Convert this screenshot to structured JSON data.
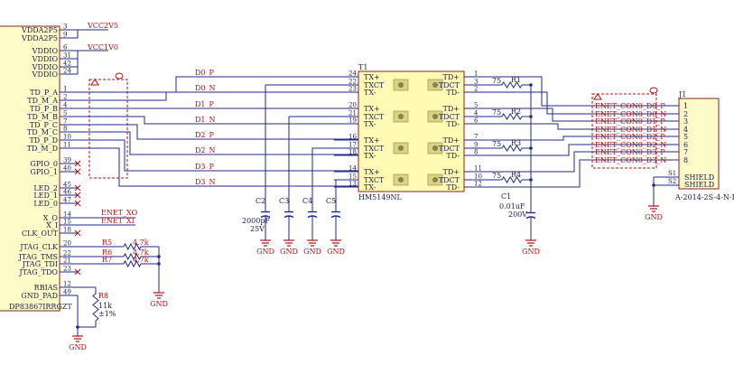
{
  "u2": {
    "name": "DP83867IRRGZT",
    "pins": [
      {
        "num": "3",
        "name": "VDDA2P5"
      },
      {
        "num": "9",
        "name": "VDDA2P5"
      },
      {
        "num": "6",
        "name": "VDDIO"
      },
      {
        "num": "31",
        "name": "VDDIO"
      },
      {
        "num": "42",
        "name": "VDDIO"
      },
      {
        "num": "24",
        "name": "VDDIO"
      },
      {
        "num": "1",
        "name": "TD_P_A"
      },
      {
        "num": "2",
        "name": "TD_M_A"
      },
      {
        "num": "4",
        "name": "TD_P_B"
      },
      {
        "num": "5",
        "name": "TD_M_B"
      },
      {
        "num": "7",
        "name": "TD_P_C"
      },
      {
        "num": "8",
        "name": "TD_M_C"
      },
      {
        "num": "10",
        "name": "TD_P_D"
      },
      {
        "num": "11",
        "name": "TD_M_D"
      },
      {
        "num": "39",
        "name": "GPIO_0"
      },
      {
        "num": "40",
        "name": "GPIO_1"
      },
      {
        "num": "45",
        "name": "LED_2"
      },
      {
        "num": "46",
        "name": "LED_1"
      },
      {
        "num": "47",
        "name": "LED_0"
      },
      {
        "num": "14",
        "name": "X_O"
      },
      {
        "num": "15",
        "name": "X_I"
      },
      {
        "num": "18",
        "name": "CLK_OUT"
      },
      {
        "num": "20",
        "name": "JTAG_CLK"
      },
      {
        "num": "22",
        "name": "JTAG_TMS"
      },
      {
        "num": "21",
        "name": "JTAG_TDI"
      },
      {
        "num": "23",
        "name": "JTAG_TDO"
      },
      {
        "num": "12",
        "name": "RBIAS"
      },
      {
        "num": "49",
        "name": "GND_PAD"
      }
    ]
  },
  "power_nets": [
    "VCC2V5",
    "VCC1V0"
  ],
  "td_nets": [
    "D0_P",
    "D0_N",
    "D1_P",
    "D1_N",
    "D2_P",
    "D2_N",
    "D3_P",
    "D3_N"
  ],
  "xtal_nets": [
    "ENET_XO",
    "ENET_XI"
  ],
  "jtag_resistors": [
    {
      "ref": "R5",
      "value": "4.7k"
    },
    {
      "ref": "R6",
      "value": "4.7k"
    },
    {
      "ref": "R7",
      "value": "4.7k"
    }
  ],
  "r8": {
    "ref": "R8",
    "value": "11k",
    "tol": "±1%"
  },
  "gnd_label": "GND",
  "caps": [
    "C2",
    "C3",
    "C4",
    "C5"
  ],
  "c2_value": "2000pF",
  "c2_voltage": "25V",
  "t1": {
    "ref": "T1",
    "name": "HM5149NL",
    "left": [
      {
        "num": "24",
        "name": "TX+"
      },
      {
        "num": "22",
        "name": "TXCT"
      },
      {
        "num": "23",
        "name": "TX-"
      },
      {
        "num": "20",
        "name": "TX+"
      },
      {
        "num": "21",
        "name": "TXCT"
      },
      {
        "num": "19",
        "name": "TX-"
      },
      {
        "num": "16",
        "name": "TX+"
      },
      {
        "num": "17",
        "name": "TXCT"
      },
      {
        "num": "18",
        "name": "TX-"
      },
      {
        "num": "14",
        "name": "TX+"
      },
      {
        "num": "15",
        "name": "TXCT"
      },
      {
        "num": "13",
        "name": "TX-"
      }
    ],
    "right": [
      {
        "num": "1",
        "name": "TD+"
      },
      {
        "num": "3",
        "name": "TDCT"
      },
      {
        "num": "2",
        "name": "TD-"
      },
      {
        "num": "5",
        "name": "TD+"
      },
      {
        "num": "4",
        "name": "TDCT"
      },
      {
        "num": "6",
        "name": "TD-"
      },
      {
        "num": "7",
        "name": "TD+"
      },
      {
        "num": "9",
        "name": "TDCT"
      },
      {
        "num": "8",
        "name": "TD-"
      },
      {
        "num": "11",
        "name": "TD+"
      },
      {
        "num": "10",
        "name": "TDCT"
      },
      {
        "num": "12",
        "name": "TD-"
      }
    ]
  },
  "term_resistors": [
    {
      "ref": "R1",
      "value": "75"
    },
    {
      "ref": "R2",
      "value": "75"
    },
    {
      "ref": "R3",
      "value": "75"
    },
    {
      "ref": "R4",
      "value": "75"
    }
  ],
  "c1": {
    "ref": "C1",
    "value": "0.01uF",
    "voltage": "200V"
  },
  "con_nets": [
    "ENET_CON0_D0_P",
    "ENET_CON0_D0_N",
    "ENET_CON0_D1_P",
    "ENET_CON0_D1_N",
    "ENET_CON0_D2_P",
    "ENET_CON0_D2_N",
    "ENET_CON0_D3_P",
    "ENET_CON0_D3_N"
  ],
  "j1": {
    "ref": "J1",
    "part": "A-2014-2S-4-N-R",
    "pins": [
      "1",
      "2",
      "3",
      "4",
      "5",
      "6",
      "7",
      "8"
    ],
    "shield_pins": [
      "S1",
      "S2"
    ],
    "shield_label": "SHIELD"
  }
}
